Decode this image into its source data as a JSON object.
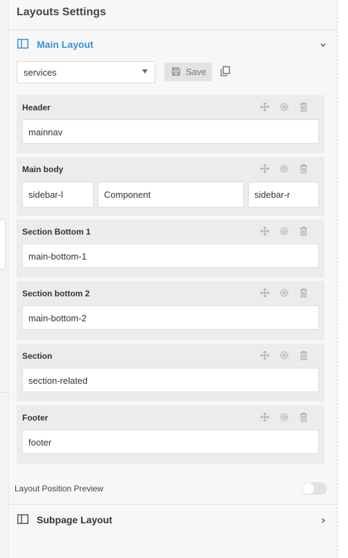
{
  "panel": {
    "title": "Layouts Settings"
  },
  "main_layout": {
    "title": "Main Layout",
    "select_value": "services",
    "save_label": "Save"
  },
  "rows": [
    {
      "title": "Header",
      "columns": [
        "mainnav"
      ]
    },
    {
      "title": "Main body",
      "columns": [
        "sidebar-l",
        "Component",
        "sidebar-r"
      ]
    },
    {
      "title": "Section Bottom 1",
      "columns": [
        "main-bottom-1"
      ]
    },
    {
      "title": "Section bottom 2",
      "columns": [
        "main-bottom-2"
      ]
    },
    {
      "title": "Section",
      "columns": [
        "section-related"
      ]
    },
    {
      "title": "Footer",
      "columns": [
        "footer"
      ]
    }
  ],
  "preview": {
    "label": "Layout Position Preview",
    "enabled": false
  },
  "subpage_layout": {
    "title": "Subpage Layout"
  },
  "colors": {
    "accent": "#3a8fd9",
    "row_bg": "#ececec",
    "panel_bg": "#f7f7f7"
  },
  "icons": [
    "layout-icon",
    "chevron-down-icon",
    "chevron-right-icon",
    "save-icon",
    "copy-icon",
    "move-icon",
    "gear-icon",
    "trash-icon"
  ]
}
